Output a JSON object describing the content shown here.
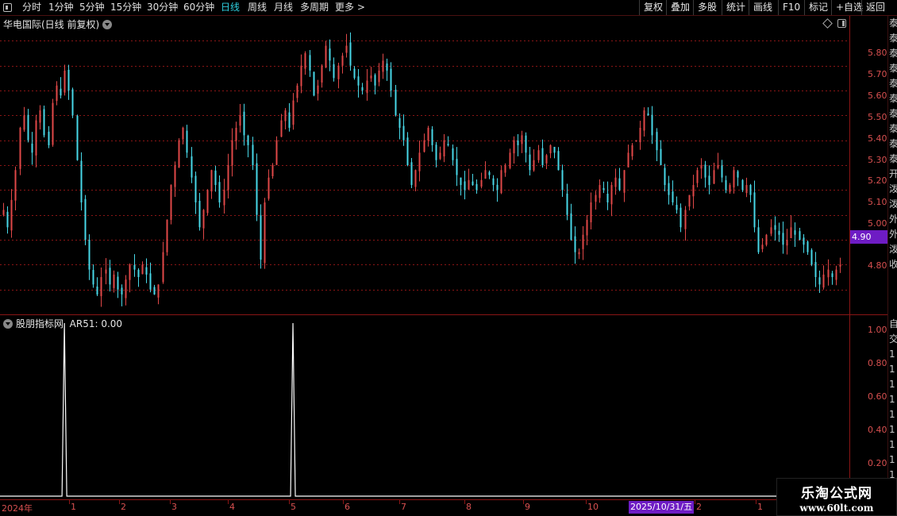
{
  "toolbar": {
    "periods": [
      {
        "label": "分时",
        "active": false
      },
      {
        "label": "1分钟",
        "active": false
      },
      {
        "label": "5分钟",
        "active": false
      },
      {
        "label": "15分钟",
        "active": false
      },
      {
        "label": "30分钟",
        "active": false
      },
      {
        "label": "60分钟",
        "active": false
      },
      {
        "label": "日线",
        "active": true
      },
      {
        "label": "周线",
        "active": false
      },
      {
        "label": "月线",
        "active": false
      },
      {
        "label": "多周期",
        "active": false
      },
      {
        "label": "更多",
        "active": false
      }
    ],
    "more_arrow": ">",
    "right_buttons": [
      "复权",
      "叠加",
      "多股",
      "统计",
      "画线",
      "F10",
      "标记",
      "+自选",
      "返回"
    ]
  },
  "main_chart": {
    "title": "华电国际(日线 前复权)",
    "y_ticks": [
      "5.80",
      "5.70",
      "5.60",
      "5.50",
      "5.40",
      "5.30",
      "5.20",
      "5.10",
      "5.00",
      "4.90",
      "4.80"
    ],
    "last_price": "4.90"
  },
  "sub_chart": {
    "title": "股朋指标网",
    "indicator": "AR51: 0.00",
    "y_ticks": [
      "1.00",
      "0.80",
      "0.60",
      "0.40",
      "0.20"
    ]
  },
  "right_strip": {
    "chars": "泰\n泰\n泰\n泰\n泰\n泰\n泰\n泰\n泰\n泰\n开\n泼\n泼\n外\n外\n泼\n收",
    "sub_chars": "自\n交\n1\n1\n1\n1\n1\n1\n1\n1\n1"
  },
  "date_axis": {
    "labels": [
      "2024年",
      "1",
      "2",
      "3",
      "4",
      "5",
      "6",
      "7",
      "8",
      "9",
      "10",
      "2",
      "1"
    ],
    "cursor_label": "2025/10/31/五"
  },
  "watermark": {
    "title": "乐淘公式网",
    "url": "www.60lt.com"
  },
  "colors": {
    "up": "#e04848",
    "down": "#48d8e8",
    "axis": "#d85050",
    "grid": "#8a1515",
    "highlight": "#6e1cc4",
    "active_tab": "#2fd0e0"
  },
  "chart_data": {
    "type": "candlestick",
    "y_range": [
      4.7,
      5.9
    ],
    "closes": [
      5.12,
      5.05,
      5.16,
      5.28,
      5.45,
      5.5,
      5.4,
      5.35,
      5.48,
      5.52,
      5.42,
      5.38,
      5.55,
      5.62,
      5.58,
      5.68,
      5.6,
      5.5,
      5.32,
      5.15,
      5.0,
      4.88,
      4.82,
      4.78,
      4.85,
      4.88,
      4.82,
      4.86,
      4.8,
      4.78,
      4.84,
      4.9,
      4.88,
      4.85,
      4.9,
      4.86,
      4.8,
      4.78,
      4.82,
      4.95,
      5.08,
      5.22,
      5.3,
      5.4,
      5.45,
      5.35,
      5.25,
      5.15,
      5.05,
      5.12,
      5.2,
      5.28,
      5.22,
      5.15,
      5.2,
      5.3,
      5.4,
      5.45,
      5.5,
      5.42,
      5.38,
      5.3,
      5.1,
      4.92,
      5.15,
      5.25,
      5.3,
      5.4,
      5.48,
      5.52,
      5.45,
      5.56,
      5.62,
      5.7,
      5.75,
      5.68,
      5.58,
      5.62,
      5.7,
      5.78,
      5.72,
      5.65,
      5.7,
      5.74,
      5.78,
      5.7,
      5.65,
      5.62,
      5.6,
      5.64,
      5.66,
      5.62,
      5.68,
      5.72,
      5.68,
      5.6,
      5.5,
      5.45,
      5.4,
      5.3,
      5.22,
      5.28,
      5.35,
      5.4,
      5.45,
      5.38,
      5.32,
      5.35,
      5.4,
      5.38,
      5.32,
      5.26,
      5.22,
      5.2,
      5.24,
      5.22,
      5.2,
      5.24,
      5.28,
      5.26,
      5.22,
      5.2,
      5.28,
      5.3,
      5.35,
      5.4,
      5.38,
      5.42,
      5.35,
      5.28,
      5.32,
      5.36,
      5.3,
      5.34,
      5.38,
      5.35,
      5.28,
      5.2,
      5.1,
      5.0,
      4.95,
      4.95,
      5.02,
      5.08,
      5.15,
      5.18,
      5.22,
      5.2,
      5.15,
      5.22,
      5.25,
      5.2,
      5.28,
      5.35,
      5.38,
      5.4,
      5.45,
      5.52,
      5.5,
      5.42,
      5.36,
      5.3,
      5.22,
      5.18,
      5.15,
      5.12,
      5.05,
      5.12,
      5.18,
      5.22,
      5.28,
      5.3,
      5.25,
      5.22,
      5.28,
      5.3,
      5.25,
      5.2,
      5.22,
      5.28,
      5.25,
      5.2,
      5.22,
      5.18,
      5.05,
      4.95,
      4.98,
      5.02,
      5.05,
      5.04,
      5.02,
      4.98,
      5.0,
      5.05,
      5.02,
      5.0,
      4.98,
      4.95,
      4.9,
      4.85,
      4.82,
      4.86,
      4.88,
      4.85,
      4.88,
      4.9
    ],
    "ar51_spikes": [
      {
        "x_index": 15,
        "value": 1.0
      },
      {
        "x_index": 71,
        "value": 1.0
      }
    ],
    "ar51_last": 0.0
  }
}
